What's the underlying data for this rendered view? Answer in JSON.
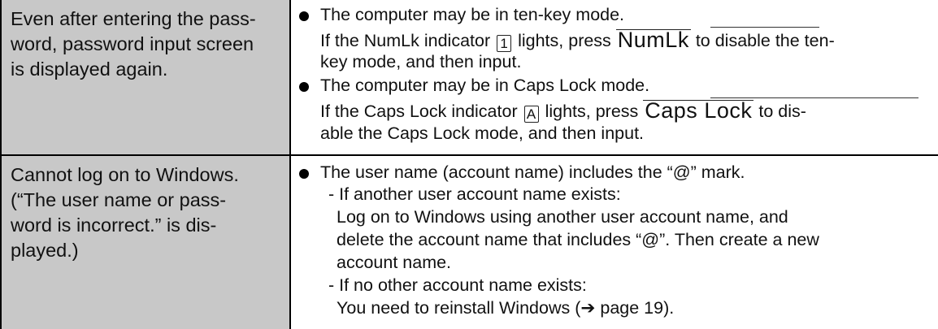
{
  "rows": [
    {
      "problem": "Even after entering the pass-\nword, password input screen\nis displayed again.",
      "solutions": [
        {
          "main": "The computer may be in ten-key mode.",
          "detail1_pre": "If the NumLk indicator",
          "detail1_icon": "1",
          "detail1_mid": "lights, press",
          "detail1_key": "NumLk",
          "detail1_post": "to disable the ten-",
          "detail2": "key mode, and then input."
        },
        {
          "main": "The computer may be in Caps Lock mode.",
          "detail1_pre": "If the Caps Lock indicator",
          "detail1_icon": "A",
          "detail1_mid": "lights, press",
          "detail1_key": "Caps Lock",
          "detail1_post": "to dis-",
          "detail2": "able the Caps Lock mode, and then input."
        }
      ]
    },
    {
      "problem": "Cannot log on to Windows.\n(“The user name or pass-\nword is incorrect.” is dis-\nplayed.)",
      "solution": {
        "main": "The user name (account name) includes the “@” mark.",
        "lines": [
          "- If another user account name exists:",
          "Log on to Windows using another user account name, and",
          "delete the account name that includes “@”. Then create a new",
          "account name.",
          "- If no other account name exists:",
          "You need to reinstall Windows (➔ page 19)."
        ]
      }
    }
  ]
}
